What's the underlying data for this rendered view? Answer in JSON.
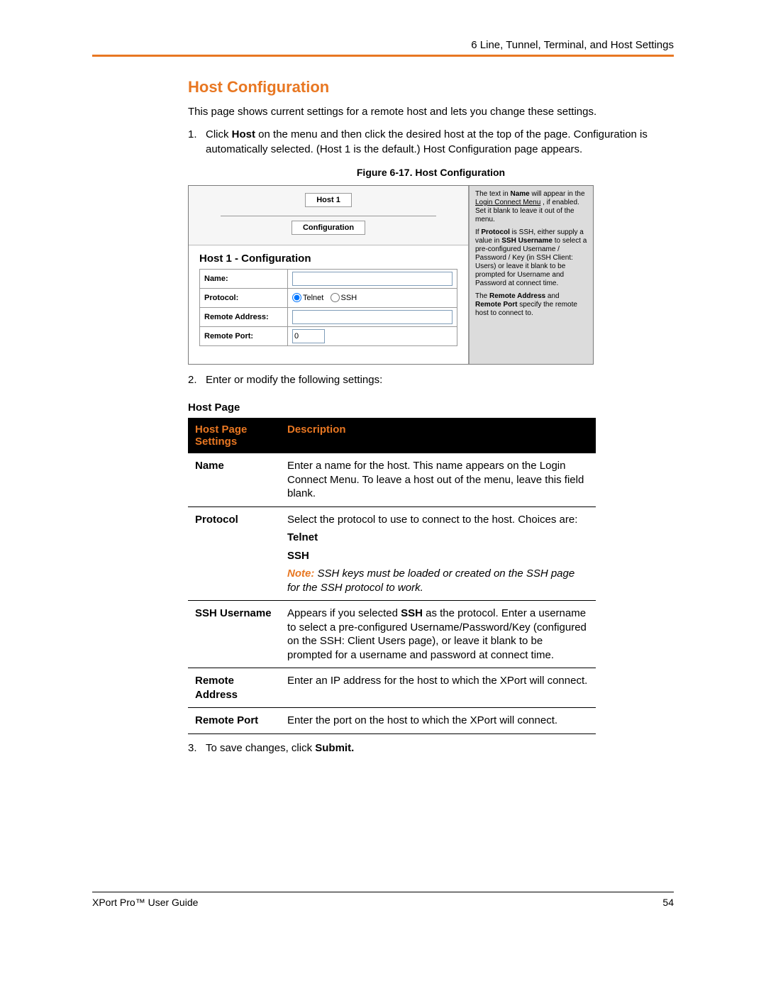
{
  "header": {
    "chapter": "6 Line, Tunnel, Terminal, and Host Settings"
  },
  "section": {
    "title": "Host Configuration",
    "intro": "This page shows current settings for a remote host and lets you change these settings.",
    "step1_pre": "Click ",
    "step1_bold": "Host",
    "step1_post": " on the menu and then click the desired host at the top of the page. Configuration is automatically selected. (Host 1 is the default.) Host Configuration page appears.",
    "figure_caption": "Figure 6-17. Host Configuration",
    "step2": "Enter or modify the following settings:",
    "step3_pre": "To save changes, click ",
    "step3_bold": "Submit."
  },
  "screenshot": {
    "host_button": "Host 1",
    "config_button": "Configuration",
    "heading": "Host 1 - Configuration",
    "row_name": "Name:",
    "row_protocol": "Protocol:",
    "row_remote_addr": "Remote Address:",
    "row_remote_port": "Remote Port:",
    "proto_telnet": "Telnet",
    "proto_ssh": "SSH",
    "port_value": "0",
    "help1a": "The text in ",
    "help1b": "Name",
    "help1c": " will appear in the ",
    "help1d": "Login Connect Menu",
    "help1e": " , if enabled. Set it blank to leave it out of the menu.",
    "help2a": "If ",
    "help2b": "Protocol",
    "help2c": " is SSH, either supply a value in ",
    "help2d": "SSH Username",
    "help2e": " to select a pre-configured Username / Password / Key (in SSH Client: Users) or leave it blank to be prompted for Username and Password at connect time.",
    "help3a": "The ",
    "help3b": "Remote Address",
    "help3c": " and ",
    "help3d": "Remote Port",
    "help3e": " specify the remote host to connect to."
  },
  "hostpage": {
    "subtitle": "Host Page",
    "col1": "Host Page Settings",
    "col2": "Description",
    "rows": [
      {
        "label": "Name",
        "desc": "Enter a name for the host. This name appears on the Login Connect Menu. To leave a host out of the menu, leave this field blank."
      },
      {
        "label": "Protocol",
        "desc_intro": "Select the protocol to use to connect to the host. Choices are:",
        "choice1": "Telnet",
        "choice2": "SSH",
        "note_label": "Note:",
        "note_text": " SSH keys must be loaded or created on the SSH page for the SSH protocol to work."
      },
      {
        "label": "SSH Username",
        "desc_pre": "Appears if you selected ",
        "desc_bold": "SSH",
        "desc_post": " as the protocol. Enter a username to select a pre-configured Username/Password/Key (configured on the SSH: Client Users page), or leave it blank to be prompted for a username and password at connect time."
      },
      {
        "label": "Remote Address",
        "desc": "Enter an IP address for the host to which the XPort will connect."
      },
      {
        "label": "Remote Port",
        "desc": "Enter the port on the host to which the XPort will connect."
      }
    ]
  },
  "footer": {
    "left": "XPort Pro™ User Guide",
    "right": "54"
  }
}
